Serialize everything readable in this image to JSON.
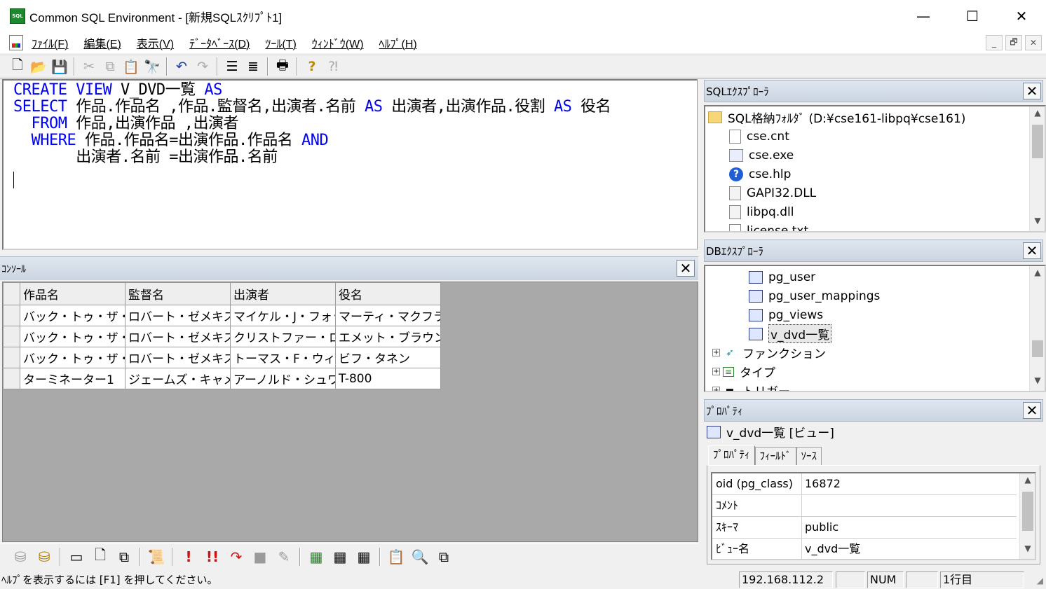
{
  "window": {
    "title": "Common SQL Environment - [新規SQLｽｸﾘﾌﾟﾄ1]",
    "app_icon_text": "SQL",
    "minimize": "—",
    "maximize": "☐",
    "close": "✕"
  },
  "menu": {
    "items": [
      "ﾌｧｲﾙ(F)",
      "編集(E)",
      "表示(V)",
      "ﾃﾞｰﾀﾍﾞｰｽ(D)",
      "ﾂｰﾙ(T)",
      "ｳｨﾝﾄﾞｳ(W)",
      "ﾍﾙﾌﾟ(H)"
    ],
    "mdi_minimize": "_",
    "mdi_restore": "🗗",
    "mdi_close": "✕"
  },
  "editor": {
    "lines": [
      [
        {
          "t": "CREATE VIEW",
          "k": true
        },
        {
          "t": " V_DVD一覧 ",
          "k": false
        },
        {
          "t": "AS",
          "k": true
        }
      ],
      [
        {
          "t": "SELECT",
          "k": true
        },
        {
          "t": " 作品.作品名 ,作品.監督名,出演者.名前 ",
          "k": false
        },
        {
          "t": "AS",
          "k": true
        },
        {
          "t": " 出演者,出演作品.役割 ",
          "k": false
        },
        {
          "t": "AS",
          "k": true
        },
        {
          "t": " 役名",
          "k": false
        }
      ],
      [
        {
          "t": "  FROM",
          "k": true
        },
        {
          "t": " 作品,出演作品 ,出演者",
          "k": false
        }
      ],
      [
        {
          "t": "  WHERE",
          "k": true
        },
        {
          "t": " 作品.作品名=出演作品.作品名 ",
          "k": false
        },
        {
          "t": "AND",
          "k": true
        }
      ],
      [
        {
          "t": "       出演者.名前 =出演作品.名前",
          "k": false
        }
      ]
    ]
  },
  "console": {
    "title": "ｺﾝｿｰﾙ",
    "close": "✕",
    "columns": [
      "作品名",
      "監督名",
      "出演者",
      "役名"
    ],
    "rows": [
      [
        "バック・トゥ・ザ・フュー",
        "ロバート・ゼメキス",
        "マイケル・J・フォックス",
        "マーティ・マクフライ"
      ],
      [
        "バック・トゥ・ザ・フュー",
        "ロバート・ゼメキス",
        "クリストファー・ロイド",
        "エメット・ブラウン博士"
      ],
      [
        "バック・トゥ・ザ・フュー",
        "ロバート・ゼメキス",
        "トーマス・F・ウィルソン",
        "ビフ・タネン"
      ],
      [
        "ターミネーター1",
        "ジェームズ・キャメロン",
        "アーノルド・シュワルツ",
        "T-800"
      ]
    ]
  },
  "sql_explorer": {
    "title": "SQLｴｸｽﾌﾟﾛｰﾗ",
    "close": "✕",
    "root": "SQL格納ﾌｫﾙﾀﾞ (D:¥cse161-libpq¥cse161)",
    "files": [
      "cse.cnt",
      "cse.exe",
      "cse.hlp",
      "GAPI32.DLL",
      "libpq.dll",
      "license.txt"
    ]
  },
  "db_explorer": {
    "title": "DBｴｸｽﾌﾟﾛｰﾗ",
    "close": "✕",
    "views": [
      "pg_user",
      "pg_user_mappings",
      "pg_views",
      "v_dvd一覧"
    ],
    "groups": [
      "ファンクション",
      "タイプ",
      "トリガー"
    ]
  },
  "properties": {
    "title": "ﾌﾟﾛﾊﾟﾃｨ",
    "close": "✕",
    "object": "v_dvd一覧 [ビュー]",
    "tabs": [
      "ﾌﾟﾛﾊﾟﾃｨ",
      "ﾌｨｰﾙﾄﾞ",
      "ｿｰｽ"
    ],
    "rows": [
      {
        "key": "oid (pg_class)",
        "value": "16872"
      },
      {
        "key": "ｺﾒﾝﾄ",
        "value": ""
      },
      {
        "key": "ｽｷｰﾏ",
        "value": "public"
      },
      {
        "key": "ﾋﾞｭｰ名",
        "value": "v_dvd一覧"
      }
    ]
  },
  "status": {
    "help_text": "ﾍﾙﾌﾟを表示するには [F1] を押してください。",
    "host": "192.168.112.2",
    "num": "NUM",
    "line": "1行目"
  }
}
